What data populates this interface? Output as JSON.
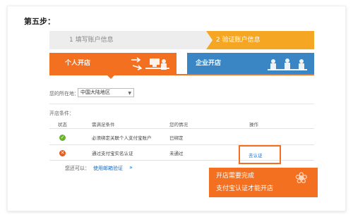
{
  "step_title": "第五步：",
  "progress": {
    "step1": "1 填写账户信息",
    "step2": "2 验证账户信息"
  },
  "cards": {
    "personal": "个人开店",
    "company": "企业开店"
  },
  "location": {
    "label": "您的所在地：",
    "value": "中国大陆地区"
  },
  "conditions_label": "开店条件：",
  "table": {
    "headers": [
      "状态",
      "需满足条件",
      "您的情况",
      "操作"
    ],
    "rows": [
      {
        "status": "ok",
        "condition": "必须绑定关联个人支付宝账户",
        "situation": "已绑定",
        "action": ""
      },
      {
        "status": "error",
        "condition": "通过支付宝实名认证",
        "situation": "未通过",
        "action": "去认证"
      }
    ]
  },
  "alternative": {
    "label": "您还可以：",
    "link": "使用邮箱验证",
    "arrow": "»"
  },
  "callout": {
    "line1": "开店需要完成",
    "line2": "支付宝认证才能开店"
  },
  "colors": {
    "orange": "#f37021",
    "blue": "#3a85c4",
    "progress_active": "#f5a623",
    "link": "#1b6ec2"
  }
}
